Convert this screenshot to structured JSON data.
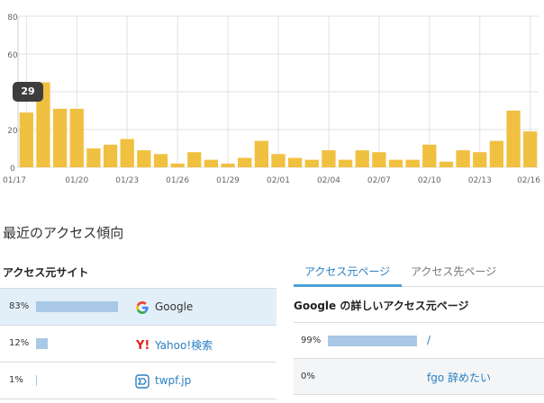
{
  "chart_data": {
    "type": "bar",
    "color": "#f0c040",
    "ylim": [
      0,
      80
    ],
    "yticks": [
      0,
      20,
      40,
      60,
      80
    ],
    "ytick_labels": [
      "0",
      "20",
      "",
      "60",
      "80"
    ],
    "xtick_labels": [
      {
        "index": 0,
        "label": "01/17"
      },
      {
        "index": 3,
        "label": "01/20"
      },
      {
        "index": 6,
        "label": "01/23"
      },
      {
        "index": 9,
        "label": "01/26"
      },
      {
        "index": 12,
        "label": "01/29"
      },
      {
        "index": 15,
        "label": "02/01"
      },
      {
        "index": 18,
        "label": "02/04"
      },
      {
        "index": 21,
        "label": "02/07"
      },
      {
        "index": 24,
        "label": "02/10"
      },
      {
        "index": 27,
        "label": "02/13"
      },
      {
        "index": 30,
        "label": "02/16"
      }
    ],
    "values": [
      29,
      45,
      31,
      31,
      10,
      12,
      15,
      9,
      7,
      2,
      8,
      4,
      2,
      5,
      14,
      7,
      5,
      4,
      9,
      4,
      9,
      8,
      4,
      4,
      12,
      3,
      9,
      8,
      14,
      30,
      19
    ],
    "grid": true
  },
  "tooltip": {
    "value": "29"
  },
  "section_title": "最近のアクセス傾向",
  "sites": {
    "header": "アクセス元サイト",
    "rows": [
      {
        "pct": "83%",
        "fraction": 0.83,
        "name": "Google",
        "icon": "google-icon",
        "link": false,
        "selected": true
      },
      {
        "pct": "12%",
        "fraction": 0.12,
        "name": "Yahoo!検索",
        "icon": "yahoo-icon",
        "link": true,
        "selected": false
      },
      {
        "pct": "1%",
        "fraction": 0.01,
        "name": "twpf.jp",
        "icon": "twpf-icon",
        "link": true,
        "selected": false
      }
    ]
  },
  "tabs": {
    "active": "アクセス元ページ",
    "inactive": "アクセス先ページ"
  },
  "detail": {
    "title": "Google の詳しいアクセス元ページ",
    "rows": [
      {
        "pct": "99%",
        "fraction": 0.99,
        "path": "/"
      },
      {
        "pct": "0%",
        "fraction": 0.0,
        "path": "fgo 辞めたい"
      }
    ]
  }
}
